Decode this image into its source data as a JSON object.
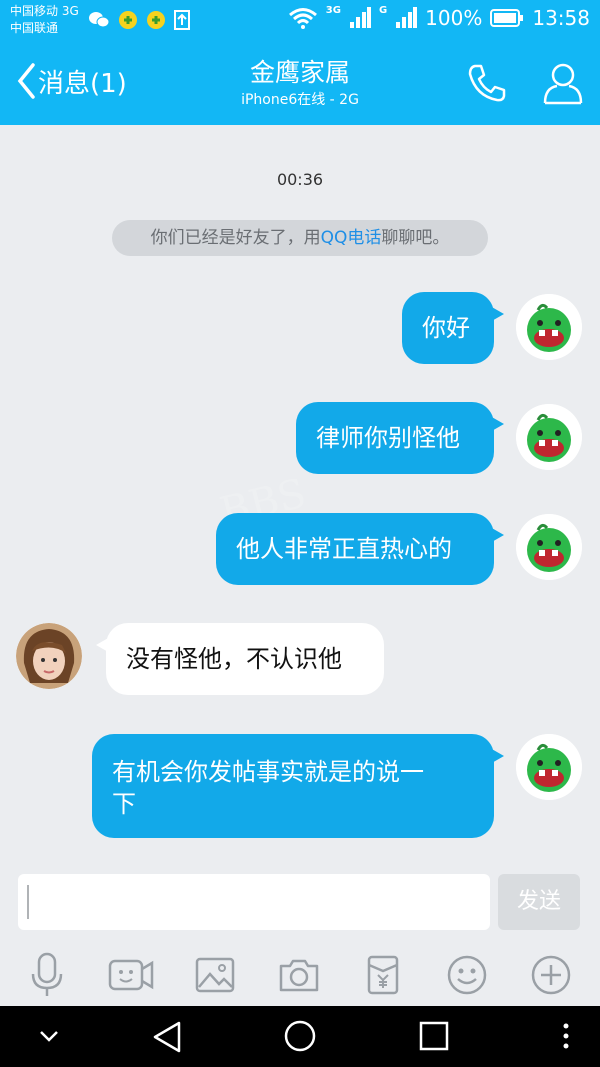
{
  "status_bar": {
    "carrier1": "中国移动 3G",
    "carrier2": "中国联通",
    "net1": "3G",
    "net2": "G",
    "battery": "100%",
    "time": "13:58"
  },
  "header": {
    "back_label": "消息(1)",
    "title": "金鹰家属",
    "subtitle": "iPhone6在线 - 2G"
  },
  "chat": {
    "timestamp": "00:36",
    "system_pre": "你们已经是好友了，用",
    "system_link": "QQ电话",
    "system_post": "聊聊吧。",
    "messages": [
      {
        "text": "你好",
        "side": "out"
      },
      {
        "text": "律师你别怪他",
        "side": "out"
      },
      {
        "text": "他人非常正直热心的",
        "side": "out"
      },
      {
        "text": "没有怪他，不认识他",
        "side": "in"
      },
      {
        "text": "有机会你发帖事实就是的说一",
        "text2": "下",
        "side": "out"
      }
    ]
  },
  "input": {
    "value": "",
    "send_label": "发送"
  },
  "toolbar_icons": [
    "microphone-icon",
    "video-icon",
    "image-icon",
    "camera-icon",
    "red-packet-icon",
    "emoji-icon",
    "plus-icon"
  ],
  "watermark": "BBS",
  "colors": {
    "accent": "#12b7f5",
    "bubble_out": "#12a9e9",
    "bubble_in": "#ffffff",
    "background": "#ebedf0"
  }
}
